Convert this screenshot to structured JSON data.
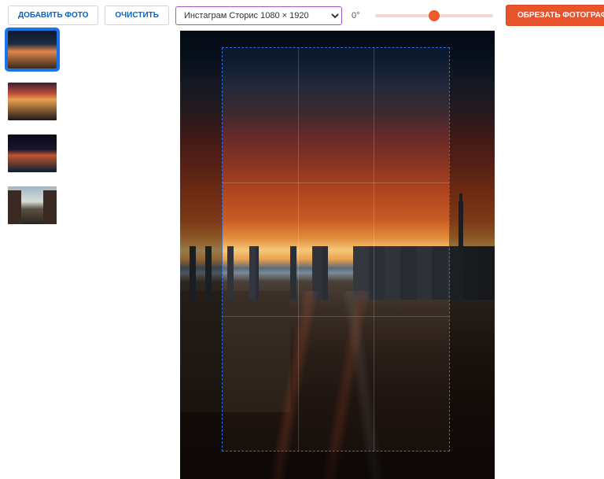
{
  "toolbar": {
    "add_photo": "ДОБАВИТЬ ФОТО",
    "clear": "ОЧИСТИТЬ",
    "crop": "ОБРЕЗАТЬ ФОТОГРАФИИ"
  },
  "preset": {
    "selected": "Инстаграм Сторис 1080 × 1920"
  },
  "rotation": {
    "label": "0°",
    "value": 0,
    "min": -45,
    "max": 45
  },
  "thumbnails": [
    {
      "id": 0,
      "active": true
    },
    {
      "id": 1,
      "active": false
    },
    {
      "id": 2,
      "active": false
    },
    {
      "id": 3,
      "active": false
    }
  ]
}
